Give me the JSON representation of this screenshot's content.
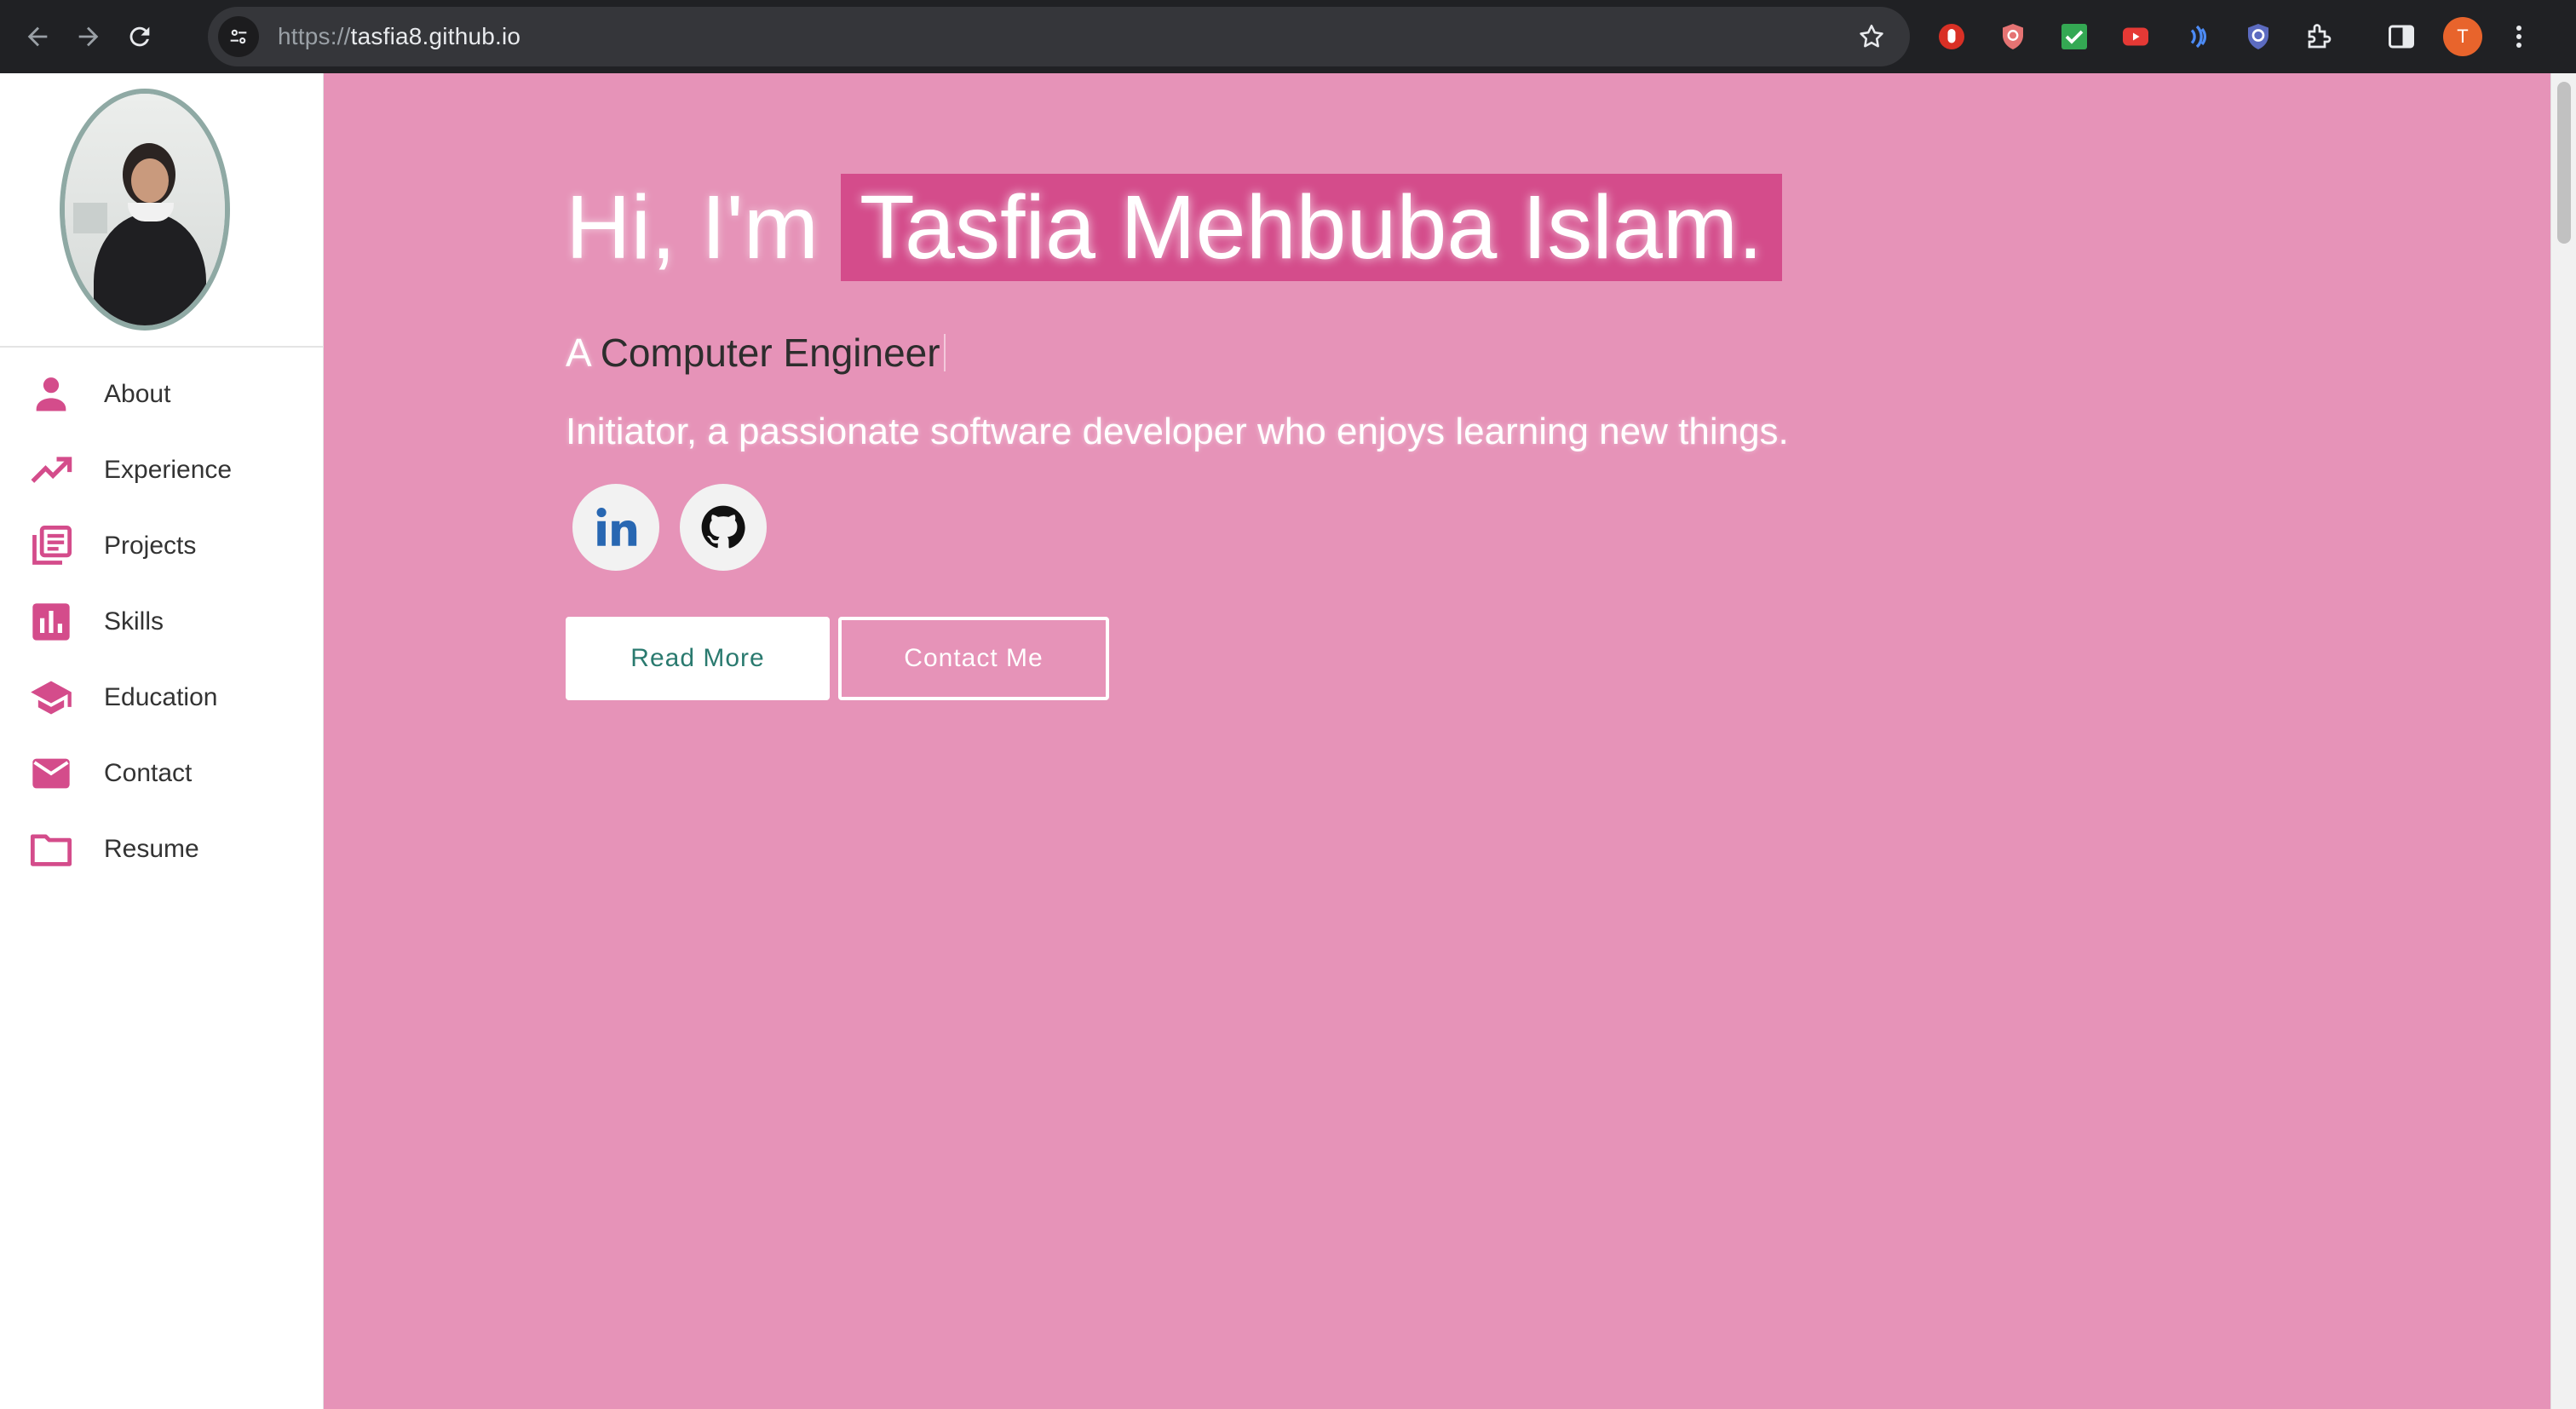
{
  "browser": {
    "url_protocol": "https://",
    "url_host": "tasfia8.github.io",
    "profile_initial": "T",
    "extensions": [
      "hand-stop-icon",
      "shield-icon",
      "checkmark-icon",
      "youtube-icon",
      "wave-icon",
      "shield-check-icon",
      "puzzle-icon",
      "sidepanel-icon"
    ]
  },
  "sidebar": {
    "items": [
      {
        "label": "About",
        "icon": "person-icon"
      },
      {
        "label": "Experience",
        "icon": "trending-up-icon"
      },
      {
        "label": "Projects",
        "icon": "library-books-icon"
      },
      {
        "label": "Skills",
        "icon": "bar-chart-icon"
      },
      {
        "label": "Education",
        "icon": "school-icon"
      },
      {
        "label": "Contact",
        "icon": "mail-icon"
      },
      {
        "label": "Resume",
        "icon": "folder-icon"
      }
    ],
    "icon_color": "#d44c8b"
  },
  "hero": {
    "greeting": "Hi, I'm",
    "name": "Tasfia Mehbuba Islam.",
    "subtitle_prefix": "A",
    "subtitle_role": "Computer Engineer",
    "tagline": "Initiator, a passionate software developer who enjoys learning new things.",
    "socials": [
      "linkedin-icon",
      "github-icon"
    ],
    "read_more_label": "Read More",
    "contact_label": "Contact Me"
  },
  "colors": {
    "background": "#e693b8",
    "name_highlight": "#d44c8b",
    "primary_button_text": "#2a7a6f"
  }
}
